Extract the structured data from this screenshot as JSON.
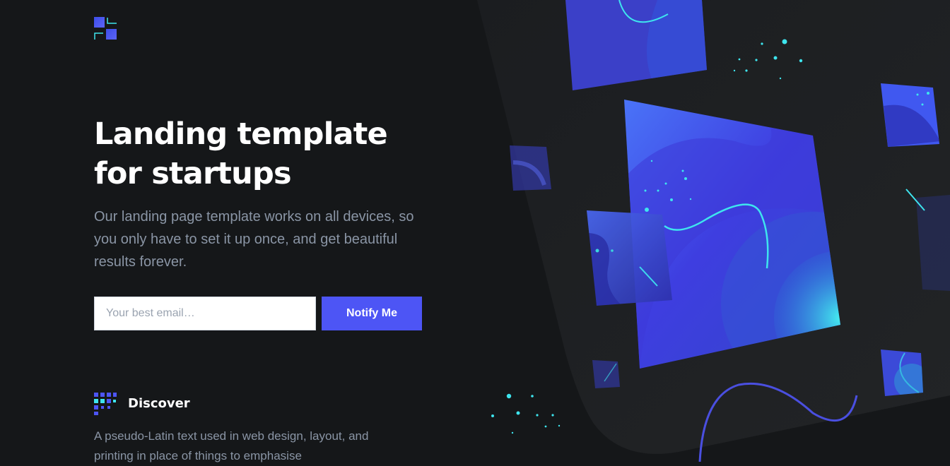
{
  "hero": {
    "title": "Landing template for startups",
    "paragraph": "Our landing page template works on all devices, so you only have to set it up once, and get beautiful results forever."
  },
  "signup": {
    "email_placeholder": "Your best email…",
    "button_label": "Notify Me"
  },
  "feature": {
    "title": "Discover",
    "text": "A pseudo-Latin text used in web design, layout, and printing in place of things to emphasise"
  },
  "colors": {
    "background": "#151719",
    "accent": "#4d55f5",
    "cyan": "#3ee5ee",
    "muted_text": "#8a95a5"
  },
  "icons": {
    "logo": "logo-squares-icon",
    "feature": "grid-dots-icon"
  }
}
